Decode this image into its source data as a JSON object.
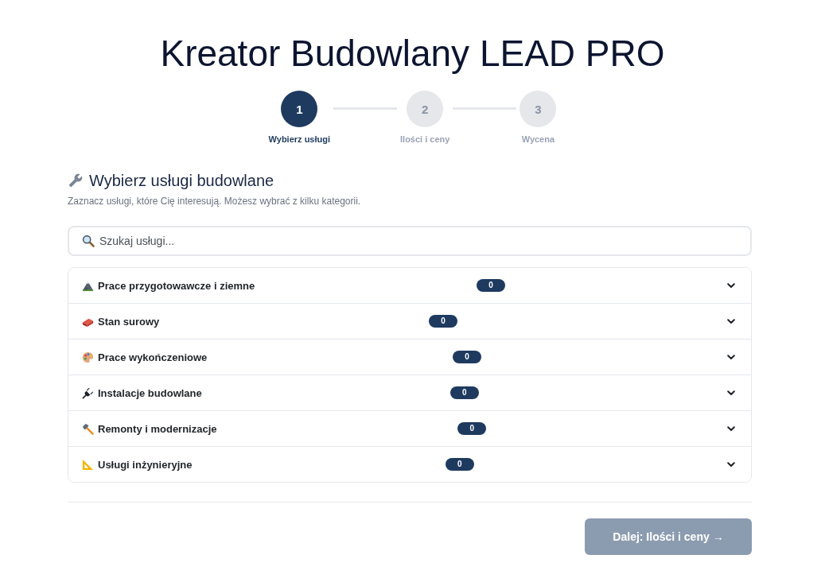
{
  "title": "Kreator Budowlany LEAD PRO",
  "steps": [
    {
      "number": "1",
      "label": "Wybierz usługi",
      "selected": true
    },
    {
      "number": "2",
      "label": "Ilości i ceny",
      "selected": false
    },
    {
      "number": "3",
      "label": "Wycena",
      "selected": false
    }
  ],
  "section": {
    "heading": "Wybierz usługi budowlane",
    "description": "Zaznacz usługi, które Cię interesują. Możesz wybrać z kilku kategorii."
  },
  "search": {
    "placeholder": "Szukaj usługi..."
  },
  "categories": [
    {
      "name": "Prace przygotowawcze i ziemne",
      "count": "0",
      "expanded": false
    },
    {
      "name": "Stan surowy",
      "count": "0",
      "expanded": false
    },
    {
      "name": "Prace wykończeniowe",
      "count": "0",
      "expanded": false
    },
    {
      "name": "Instalacje budowlane",
      "count": "0",
      "expanded": false
    },
    {
      "name": "Remonty i modernizacje",
      "count": "0",
      "expanded": false
    },
    {
      "name": "Usługi inżynieryjne",
      "count": "0",
      "expanded": false
    }
  ],
  "next_button": {
    "label": "Dalej: Ilości i ceny →",
    "disabled": true
  }
}
